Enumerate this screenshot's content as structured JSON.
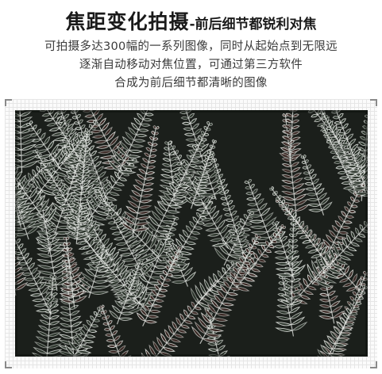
{
  "header": {
    "title_main": "焦距变化拍摄",
    "title_sub": "-前后细节都锐利对焦",
    "lines": [
      "可拍摄多达300幅的一系列图像，同时从起始点到无限远",
      "逐渐自动移动对焦位置，可通过第三方软件",
      "合成为前后细节都清晰的图像"
    ]
  },
  "photo": {
    "subject": "frost-covered-fern-leaves",
    "colors": {
      "background": "#1b1f1b",
      "frost": "#e9ece8",
      "leaf_dark": "#2c352c",
      "leaf_brown": "#3b2a26"
    }
  }
}
